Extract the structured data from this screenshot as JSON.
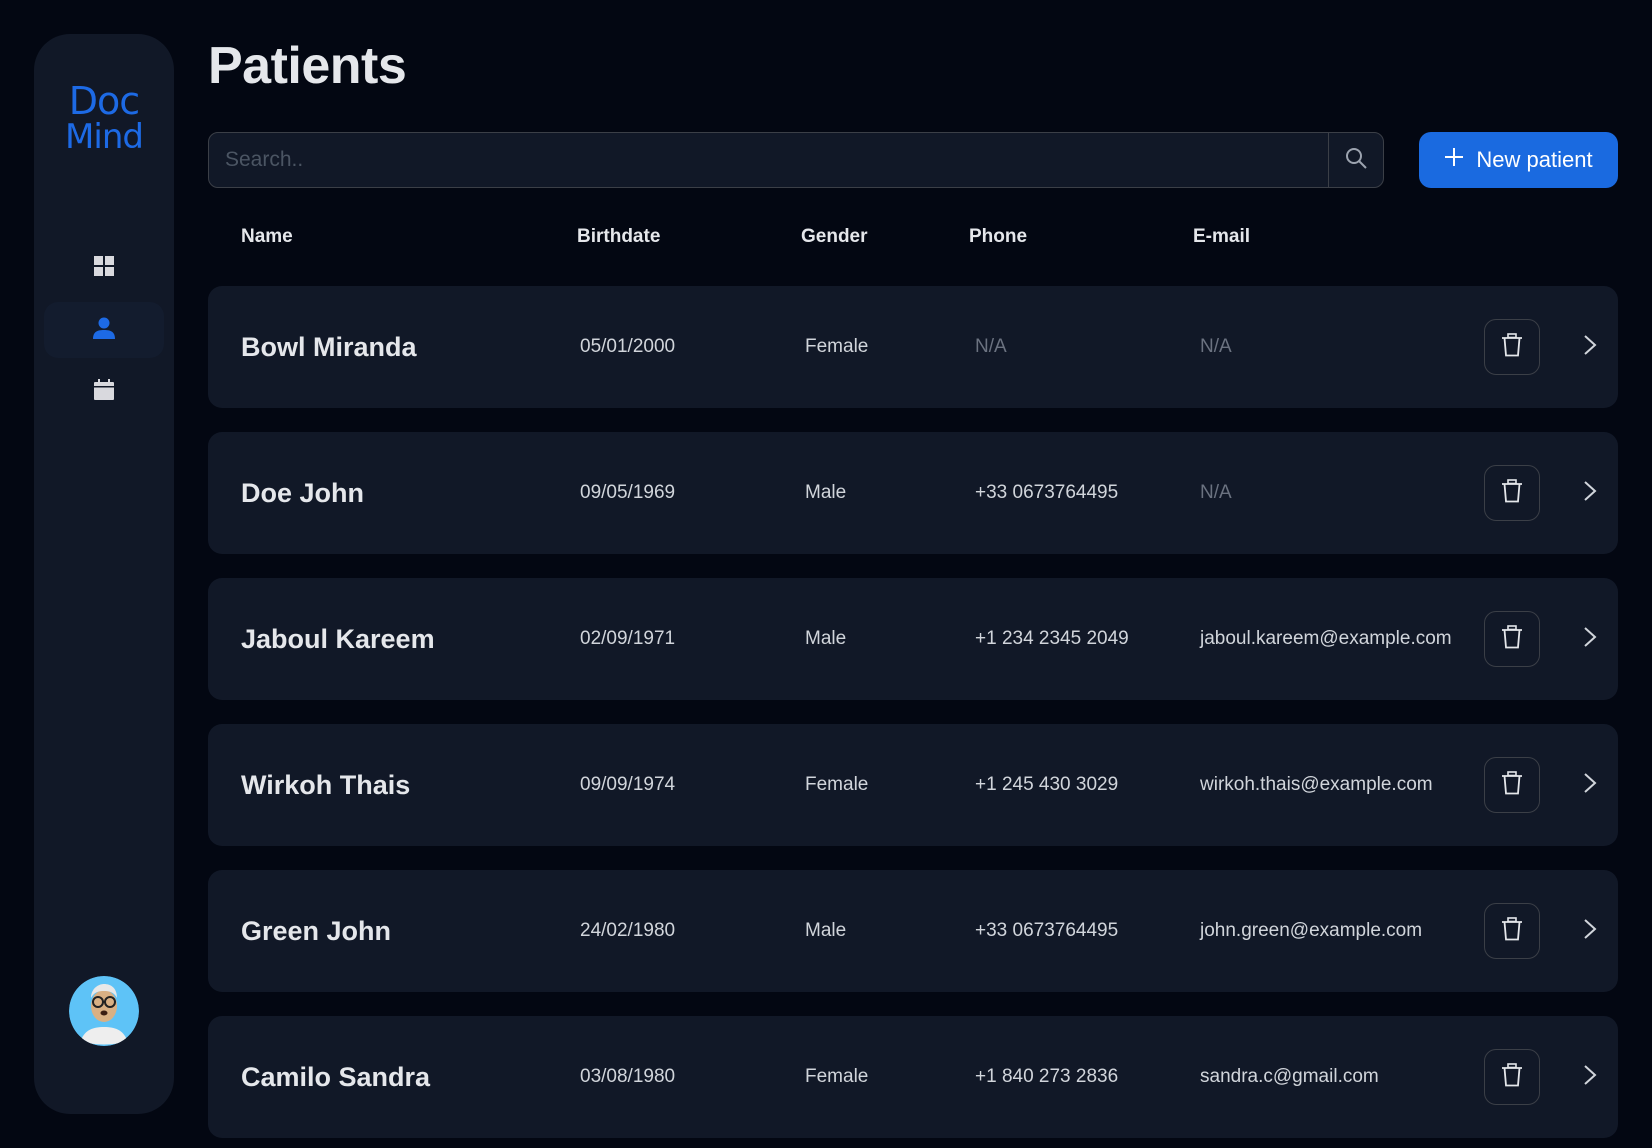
{
  "app": {
    "logo_line1": "Doc",
    "logo_line2": "Mind",
    "accent_color": "#1a6ae0"
  },
  "sidebar": {
    "items": [
      {
        "id": "dashboard",
        "icon": "grid-icon",
        "active": false
      },
      {
        "id": "patients",
        "icon": "user-icon",
        "active": true
      },
      {
        "id": "calendar",
        "icon": "calendar-icon",
        "active": false
      }
    ],
    "avatar": "user-avatar"
  },
  "header": {
    "title": "Patients",
    "search_placeholder": "Search..",
    "search_value": "",
    "new_patient_label": "New patient"
  },
  "table": {
    "columns": [
      "Name",
      "Birthdate",
      "Gender",
      "Phone",
      "E-mail"
    ],
    "rows": [
      {
        "name": "Bowl Miranda",
        "birthdate": "05/01/2000",
        "gender": "Female",
        "phone": "N/A",
        "email": "N/A"
      },
      {
        "name": "Doe John",
        "birthdate": "09/05/1969",
        "gender": "Male",
        "phone": "+33 0673764495",
        "email": "N/A"
      },
      {
        "name": "Jaboul Kareem",
        "birthdate": "02/09/1971",
        "gender": "Male",
        "phone": "+1 234 2345 2049",
        "email": "jaboul.kareem@example.com"
      },
      {
        "name": "Wirkoh Thais",
        "birthdate": "09/09/1974",
        "gender": "Female",
        "phone": "+1 245 430 3029",
        "email": "wirkoh.thais@example.com"
      },
      {
        "name": "Green John",
        "birthdate": "24/02/1980",
        "gender": "Male",
        "phone": "+33 0673764495",
        "email": "john.green@example.com"
      },
      {
        "name": "Camilo Sandra",
        "birthdate": "03/08/1980",
        "gender": "Female",
        "phone": "+1 840 273 2836",
        "email": "sandra.c@gmail.com"
      }
    ]
  }
}
